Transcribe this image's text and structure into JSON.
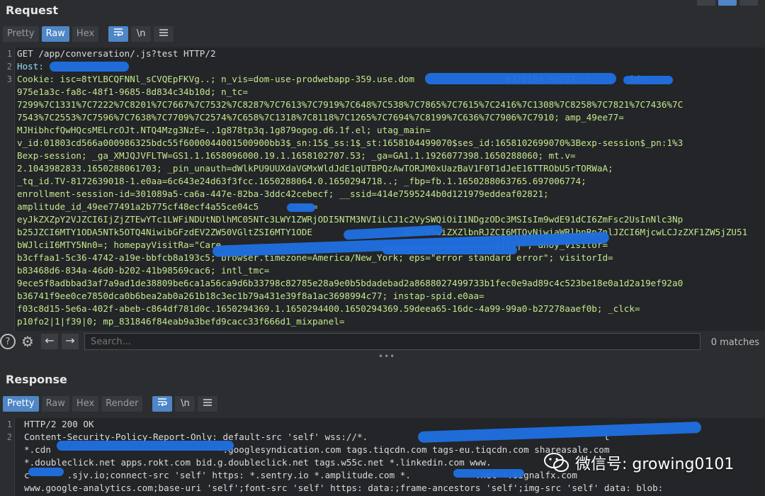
{
  "request": {
    "title": "Request",
    "tabs": [
      "Pretty",
      "Raw",
      "Hex"
    ],
    "active_tab": "Raw",
    "icons": [
      "wrap-icon",
      "newline-icon",
      "menu-icon"
    ],
    "newline_glyph": "\\n",
    "line_numbers": [
      "1",
      "2",
      "3",
      "",
      "",
      "",
      "",
      "",
      "",
      "",
      "",
      "",
      "",
      "",
      "",
      "",
      "",
      "",
      "",
      "",
      "",
      "",
      ""
    ],
    "lines": [
      "GET /app/conversation/.js?test HTTP/2",
      "Host: ",
      "Cookie: isc=8tYLBCQFNNl_sCVQEpFKVg..; n_vis=dom-use-prodwebapp-359.use.dom                 6370184 90292; c       id=",
      "975e1a3c-fa8c-48f1-9685-8d834c34b10d; n_tc=",
      "7299%7C1331%7C7222%7C8201%7C7667%7C7532%7C8287%7C7613%7C7919%7C648%7C538%7C7865%7C7615%7C2416%7C1308%7C8258%7C7821%7C7436%7C",
      "7543%7C2553%7C7596%7C7638%7C7709%7C2574%7C658%7C1318%7C8118%7C1265%7C7694%7C8199%7C636%7C7906%7C7910; amp_49ee77=",
      "MJHibhcfQwHQcsMELrcOJt.NTQ4Mzg3NzE=..1g878tp3q.1g879ogog.d6.1f.el; utag_main=",
      "v_id:01803cd566a000986325bdc55f6000044001500900bb3$_sn:15$_ss:1$_st:1658104499070$ses_id:1658102699070%3Bexp-session$_pn:1%3",
      "Bexp-session; _ga_XMJQJVFLTW=GS1.1.1658096000.19.1.1658102707.53; _ga=GA1.1.1926077398.1650288060; mt.v=",
      "2.1043982833.1650288061703; _pin_unauth=dWlkPU9UUXdaVGMxWldJdE1qUTBPQzAwTORJM0xUazBaV1F0T1dJeE16TTRObU5rTORWaA;",
      "_tq_id.TV-8172639018-1.e0aa=6c643e24d63f3fcc.1650288064.0.1650294718..; _fbp=fb.1.1650288063765.697006774;",
      "enrollment-session-id=301089a5-ca6a-447e-82ba-3ddc42cebecf; __ssid=414e7595244b0d121979eddeaf02821;",
      "amplitude_id_49ee77491a2b775cf48ecf4a55ce04c5      .com=",
      "eyJkZXZpY2VJZCI6IjZjZTEwYTc1LWFiNDUtNDlhMC05NTc3LWY1ZWRjODI5NTM3NVIiLCJ1c2VySWQiOiI1NDgzODc3MSIsIm9wdE91dCI6ZmFsc2UsInNlc3Np",
      "b25JZCI6MTY1ODA5NTk5OTQ4NiwibGFzdEV2ZW50VGltZSI6MTY1ODE                 NzOxNSwiZXZlbnRJZCI6MTQyNiwiaWRlbnRpZnlJZCI6MjcwLCJzZXF1ZW5jZU51",
      "bWJlciI6MTY5Nn0=; homepayVisitRa=\"Care                                                   |||||\"; ahoy_visitor=",
      "b3cffaa1-5c36-4742-a19e-bbfcb8a193c5; browser.timezone=America/New_York; eps=\"error standard error\"; visitorId=",
      "b83468d6-834a-46d0-b202-41b98569cac6; intl_tmc=",
      "9ece5f8adbbad3af7a9ad1de38809be6ca1a56ca9d6b33798c82785e28a9e0b5bdadebad2a8688027499733b1fec0e9ad89c4c523be18e0a1d2a19ef92a0",
      "b36741f9ee0ce7850dca0b6bea2ab0a261b18c3ec1b79a431e39f8a1ac3698994c77; instap-spid.e0aa=",
      "f03c8d15-5e6a-402f-abeb-c864df781d0c.1650294369.1.1650294400.1650294369.59deea65-16dc-4a99-99a0-b27278aaef0b; _clck=",
      "p10fo2|1|f39|0; mp_831846f84eab9a3befd9cacc33f666d1_mixpanel="
    ]
  },
  "search": {
    "placeholder": "Search...",
    "matches": "0 matches",
    "icons": [
      "help-icon",
      "settings-icon",
      "back-arrow-icon",
      "forward-arrow-icon"
    ],
    "help_glyph": "?",
    "settings_glyph": "⚙",
    "back_glyph": "←",
    "forward_glyph": "→",
    "splitter_glyph": "•••"
  },
  "response": {
    "title": "Response",
    "tabs": [
      "Pretty",
      "Raw",
      "Hex",
      "Render"
    ],
    "active_tab": "Pretty",
    "line_numbers": [
      "1",
      "2",
      "",
      "",
      "",
      ""
    ],
    "lines": [
      "HTTP/2 200 OK",
      "Content-Security-Policy-Report-Only: default-src 'self' wss://*.                                            t",
      "*.cdn                               *.googlesyndication.com tags.tiqcdn.com tags-eu.tiqcdn.com shareasale.com",
      "*.doubleclick.net apps.rokt.com bid.g.doubleclick.net tags.w55c.net *.linkedin.com www.                         ",
      "c       .sjv.io;connect-src 'self' https: *.sentry.io *.amplitude.com *.            .net *.signalfx.com",
      "www.google-analytics.com;base-uri 'self';font-src 'self' https: data:;frame-ancestors 'self';img-src 'self' data: blob:"
    ]
  },
  "watermark": {
    "text": "微信号: growing0101",
    "icon": "wechat-icon"
  },
  "colors": {
    "accent": "#4f86c6",
    "redaction": "#1f6fe0",
    "background": "#2b2d30"
  }
}
